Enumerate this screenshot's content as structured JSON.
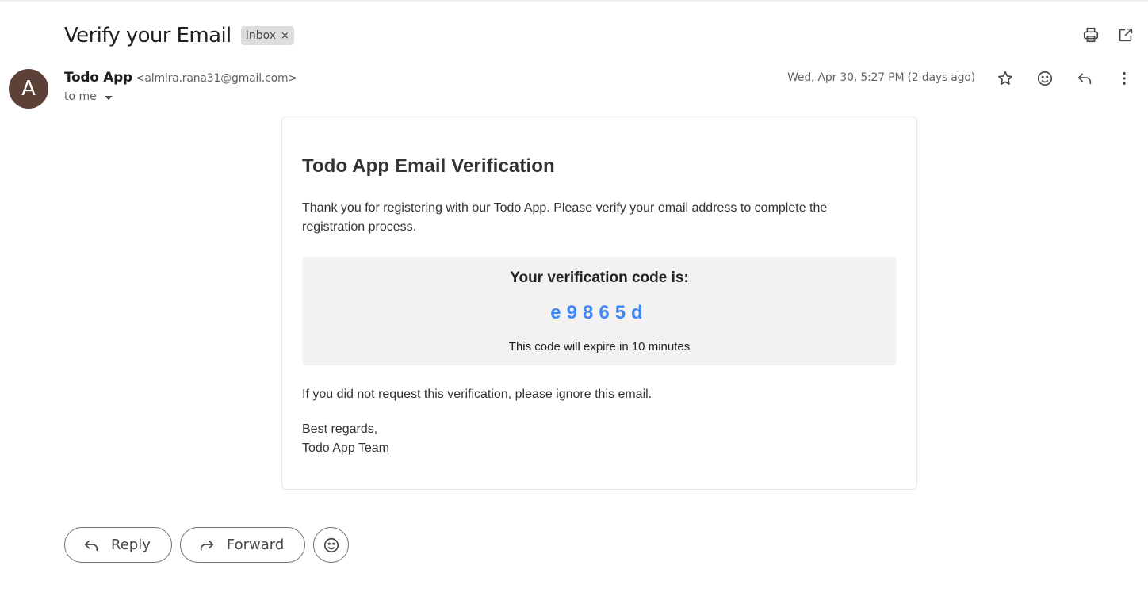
{
  "email": {
    "subject": "Verify your Email",
    "label": "Inbox",
    "label_remove": "×",
    "sender": {
      "avatar_letter": "A",
      "name": "Todo App",
      "email": "<almira.rana31@gmail.com>",
      "recipient": "to me"
    },
    "date": "Wed, Apr 30, 5:27 PM (2 days ago)",
    "icons": {
      "print": "print-icon",
      "open_new_window": "open-in-new-icon",
      "star": "star-icon",
      "emoji": "emoji-icon",
      "reply": "reply-icon",
      "more": "more-vert-icon"
    }
  },
  "body": {
    "heading": "Todo App Email Verification",
    "intro": "Thank you for registering with our Todo App. Please verify your email address to complete the registration process.",
    "code_title": "Your verification code is:",
    "code": "e9865d",
    "expire_note": "This code will expire in 10 minutes",
    "ignore_note": "If you did not request this verification, please ignore this email.",
    "sign_off": "Best regards,",
    "signature": "Todo App Team",
    "code_color": "#4285f4"
  },
  "actions": {
    "reply_label": "Reply",
    "forward_label": "Forward"
  }
}
